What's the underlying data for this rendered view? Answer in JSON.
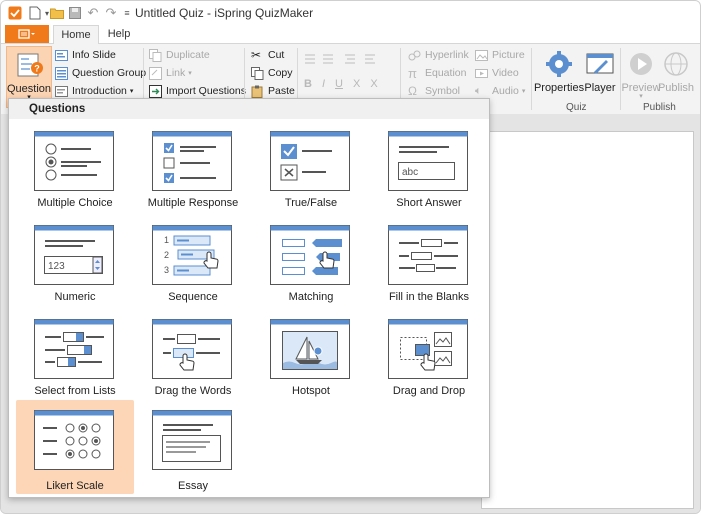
{
  "window": {
    "title": "Untitled Quiz - iSpring QuizMaker"
  },
  "tabs": [
    {
      "label": "Home"
    },
    {
      "label": "Help"
    }
  ],
  "ribbon": {
    "question_label": "Question",
    "info_slide": "Info Slide",
    "question_group": "Question Group",
    "introduction": "Introduction",
    "duplicate": "Duplicate",
    "link": "Link",
    "import_questions": "Import Questions",
    "cut": "Cut",
    "copy": "Copy",
    "paste": "Paste",
    "hyperlink": "Hyperlink",
    "equation": "Equation",
    "symbol": "Symbol",
    "picture": "Picture",
    "video": "Video",
    "audio": "Audio",
    "properties": "Properties",
    "player": "Player",
    "preview": "Preview",
    "publish": "Publish",
    "group_quiz": "Quiz",
    "group_publish": "Publish",
    "format": {
      "bold": "B",
      "italic": "I",
      "underline": "U",
      "subscript": "X",
      "superscript": "X"
    }
  },
  "dropdown": {
    "header": "Questions",
    "items": [
      {
        "label": "Multiple Choice",
        "icon": "multiple-choice-icon"
      },
      {
        "label": "Multiple Response",
        "icon": "multiple-response-icon"
      },
      {
        "label": "True/False",
        "icon": "true-false-icon"
      },
      {
        "label": "Short Answer",
        "icon": "short-answer-icon",
        "sample": "abc"
      },
      {
        "label": "Numeric",
        "icon": "numeric-icon",
        "sample": "123"
      },
      {
        "label": "Sequence",
        "icon": "sequence-icon",
        "steps": [
          "1",
          "2",
          "3"
        ]
      },
      {
        "label": "Matching",
        "icon": "matching-icon"
      },
      {
        "label": "Fill in the Blanks",
        "icon": "fill-blanks-icon"
      },
      {
        "label": "Select from Lists",
        "icon": "select-lists-icon"
      },
      {
        "label": "Drag the Words",
        "icon": "drag-words-icon"
      },
      {
        "label": "Hotspot",
        "icon": "hotspot-icon"
      },
      {
        "label": "Drag and Drop",
        "icon": "drag-drop-icon"
      },
      {
        "label": "Likert Scale",
        "icon": "likert-icon",
        "selected": true
      },
      {
        "label": "Essay",
        "icon": "essay-icon"
      }
    ]
  },
  "colors": {
    "accent": "#f07a1a",
    "selected_bg": "#fcd6b6",
    "icon_blue": "#5b8fd0",
    "icon_stroke": "#555555"
  }
}
